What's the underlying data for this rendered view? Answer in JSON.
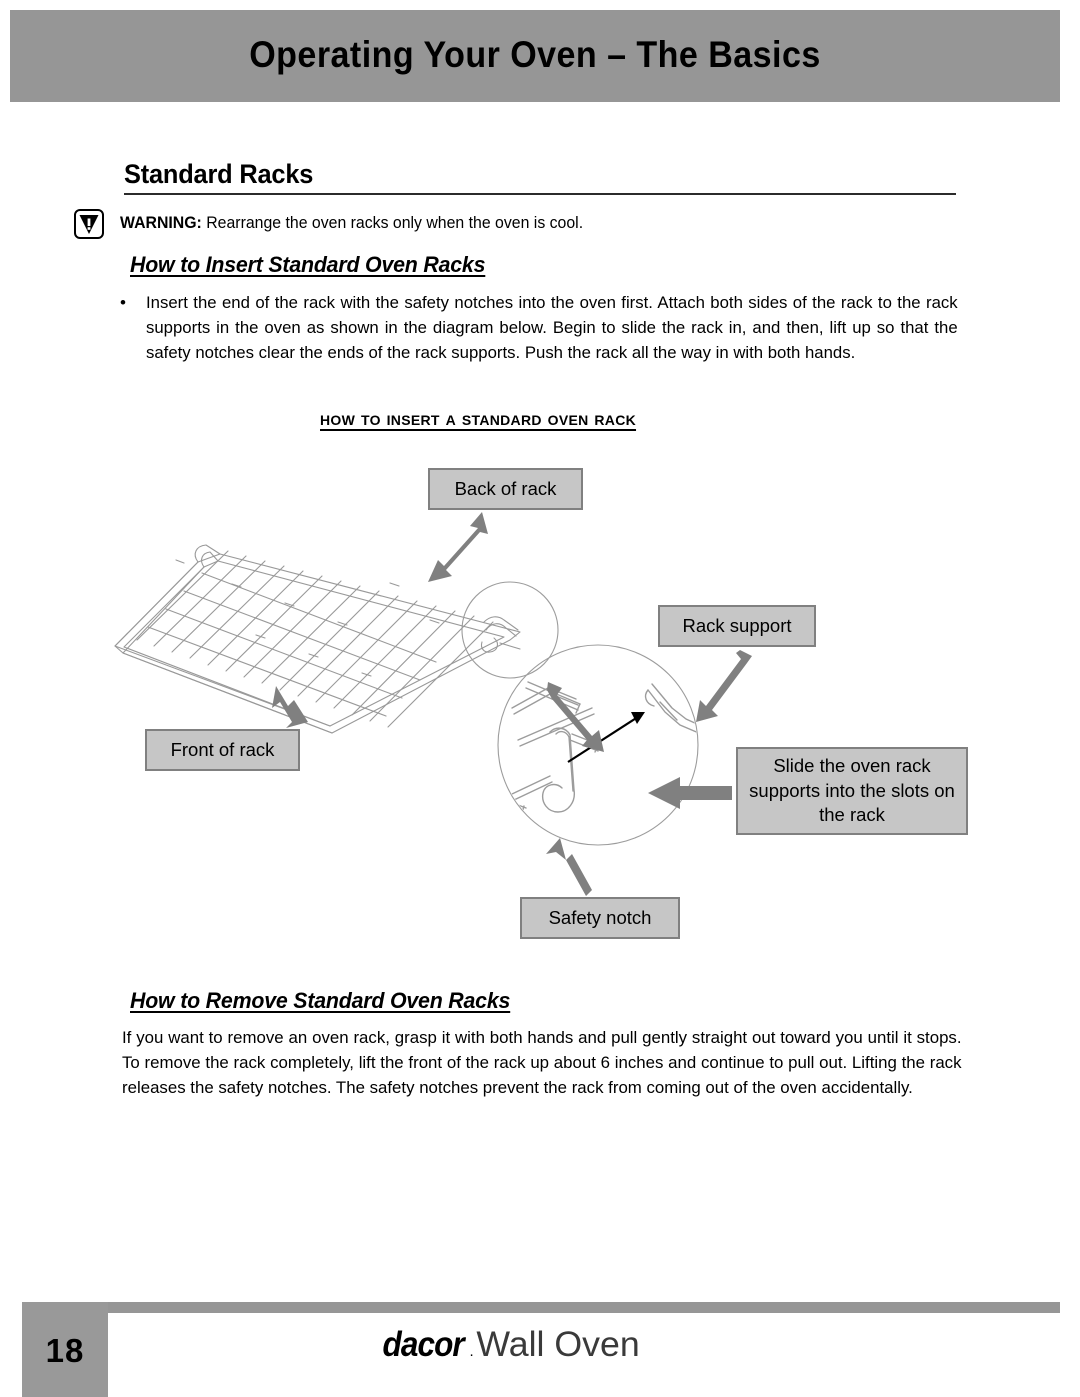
{
  "header": {
    "title": "Operating Your Oven – The Basics",
    "band_color": "#969696"
  },
  "section": {
    "title": "Standard Racks"
  },
  "warning": {
    "icon": "warning-triangle-icon",
    "label": "WARNING:",
    "text": " Rearrange the oven racks only when the oven is cool."
  },
  "insert": {
    "heading": "How to Insert Standard Oven Racks",
    "bullet_marker": "•",
    "bullet_text": "Insert the end of the rack with the safety notches into the oven first. Attach both sides of the rack to the rack supports in the oven as shown in the diagram below. Begin to slide the rack in, and then, lift up so that the safety notches clear the ends of the rack supports. Push the rack all the way in with both hands."
  },
  "figure": {
    "caption": "How to Insert a Standard Oven Rack",
    "callouts": [
      {
        "id": "back",
        "label": "Back of rack"
      },
      {
        "id": "support",
        "label": "Rack support"
      },
      {
        "id": "slide",
        "label": "Slide the oven rack supports into the slots on the rack"
      },
      {
        "id": "front",
        "label": "Front of rack"
      },
      {
        "id": "notch",
        "label": "Safety notch"
      }
    ],
    "colors": {
      "callout_fill": "#c6c6c6",
      "callout_border": "#808080",
      "arrow": "#808080",
      "line_art": "#999999"
    }
  },
  "remove": {
    "heading": "How to Remove Standard Oven Racks",
    "text": "If you want to remove an oven rack, grasp it with both hands and pull gently straight out toward you until it stops. To remove the rack completely, lift the front of the rack up about 6 inches and continue to pull out. Lifting the rack releases the safety notches. The safety notches prevent the rack from coming out of the oven accidentally."
  },
  "footer": {
    "page_number": "18",
    "brand": "dacor",
    "brand_mark": ".",
    "product": "Wall Oven",
    "bar_color": "#969696"
  }
}
